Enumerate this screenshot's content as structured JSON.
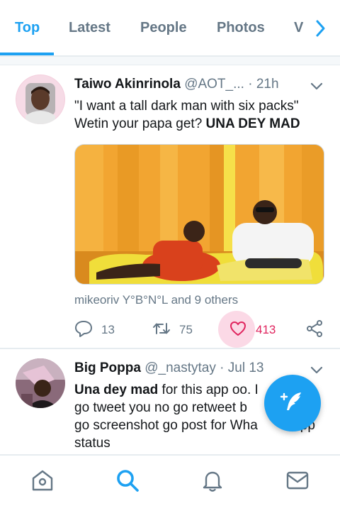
{
  "tabs": [
    {
      "label": "Top",
      "active": true
    },
    {
      "label": "Latest",
      "active": false
    },
    {
      "label": "People",
      "active": false
    },
    {
      "label": "Photos",
      "active": false
    },
    {
      "label": "V",
      "active": false
    }
  ],
  "tweets": [
    {
      "name": "Taiwo Akinrinola",
      "handle": "@AOT_...",
      "separator": "·",
      "time": "21h",
      "text_line1": "\"I want a tall dark man with six packs\"",
      "text_line2_plain": "Wetin your papa get? ",
      "text_line2_bold": "UNA DEY MAD",
      "liked_by": "mikeoriv Y°B°N°L and 9 others",
      "replies": "13",
      "retweets": "75",
      "likes": "413",
      "liked": true
    },
    {
      "name": "Big Poppa",
      "handle": "@_nastytay",
      "separator": "·",
      "time": "Jul 13",
      "text_bold": "Una dey mad",
      "text_line1_rest": " for this app oo. I",
      "text_line2": "go tweet you no go retweet b",
      "text_line3": "go screenshot go post for Wha",
      "text_line3_tail": "pp",
      "text_line4": "status"
    }
  ],
  "icons": {
    "reply": "reply-icon",
    "retweet": "retweet-icon",
    "like": "heart-icon",
    "share": "share-icon",
    "compose": "compose-tweet-icon",
    "home": "home-icon",
    "search": "search-icon",
    "notifications": "bell-icon",
    "messages": "mail-icon"
  },
  "colors": {
    "accent": "#1da1f2",
    "like": "#e0245e",
    "muted": "#657786"
  }
}
